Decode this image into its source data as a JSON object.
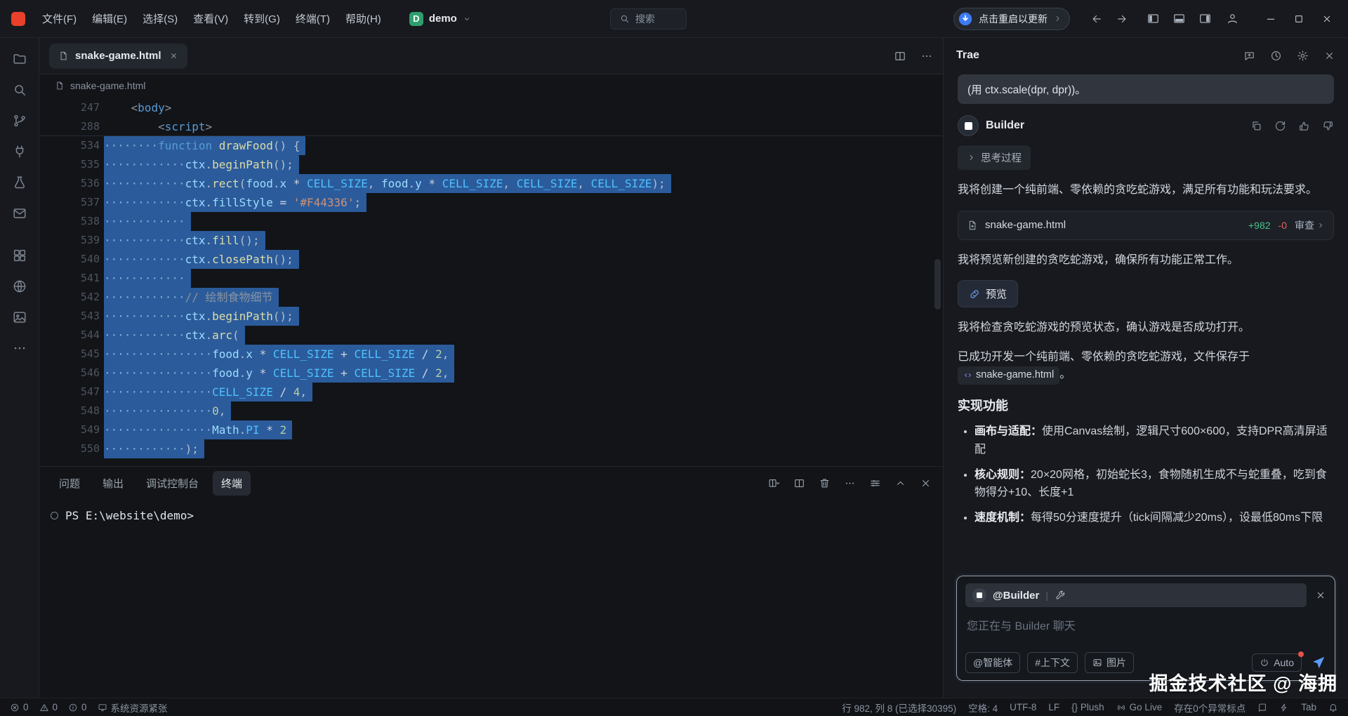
{
  "titlebar": {
    "menus": [
      "文件(F)",
      "编辑(E)",
      "选择(S)",
      "查看(V)",
      "转到(G)",
      "终端(T)",
      "帮助(H)"
    ],
    "project_initial": "D",
    "project_name": "demo",
    "search_label": "搜索",
    "update_label": "点击重启以更新"
  },
  "activity_icons": [
    "explorer",
    "search",
    "source-control",
    "debug",
    "test",
    "mail",
    "extensions",
    "globe",
    "gallery",
    "more"
  ],
  "editor": {
    "tab_name": "snake-game.html",
    "breadcrumb": "snake-game.html",
    "sticky_lines": [
      {
        "n": "247",
        "tokens": [
          [
            "    ",
            "pun"
          ],
          [
            "<",
            "dim"
          ],
          [
            "body",
            "tag"
          ],
          [
            ">",
            "dim"
          ]
        ]
      },
      {
        "n": "288",
        "tokens": [
          [
            "        ",
            "pun"
          ],
          [
            "<",
            "dim"
          ],
          [
            "script",
            "tag"
          ],
          [
            ">",
            "dim"
          ]
        ]
      }
    ],
    "code_lines": [
      {
        "n": "534",
        "sel": true,
        "ws": 8,
        "tokens": [
          [
            "function",
            "kw"
          ],
          [
            " ",
            "op"
          ],
          [
            "drawFood",
            "fn"
          ],
          [
            "() {",
            "pun"
          ]
        ]
      },
      {
        "n": "535",
        "sel": true,
        "ws": 12,
        "tokens": [
          [
            "ctx",
            "var"
          ],
          [
            ".",
            "pun"
          ],
          [
            "beginPath",
            "fn"
          ],
          [
            "();",
            "pun"
          ]
        ]
      },
      {
        "n": "536",
        "sel": true,
        "ws": 12,
        "tokens": [
          [
            "ctx",
            "var"
          ],
          [
            ".",
            "pun"
          ],
          [
            "rect",
            "fn"
          ],
          [
            "(",
            "pun"
          ],
          [
            "food",
            "var"
          ],
          [
            ".",
            "pun"
          ],
          [
            "x",
            "prop"
          ],
          [
            " * ",
            "op"
          ],
          [
            "CELL_SIZE",
            "const"
          ],
          [
            ", ",
            "pun"
          ],
          [
            "food",
            "var"
          ],
          [
            ".",
            "pun"
          ],
          [
            "y",
            "prop"
          ],
          [
            " * ",
            "op"
          ],
          [
            "CELL_SIZE",
            "const"
          ],
          [
            ", ",
            "pun"
          ],
          [
            "CELL_SIZE",
            "const"
          ],
          [
            ", ",
            "pun"
          ],
          [
            "CELL_SIZE",
            "const"
          ],
          [
            ");",
            "pun"
          ]
        ]
      },
      {
        "n": "537",
        "sel": true,
        "ws": 12,
        "tokens": [
          [
            "ctx",
            "var"
          ],
          [
            ".",
            "pun"
          ],
          [
            "fillStyle",
            "prop"
          ],
          [
            " = ",
            "op"
          ],
          [
            "'#F44336'",
            "str"
          ],
          [
            ";",
            "pun"
          ]
        ]
      },
      {
        "n": "538",
        "sel": true,
        "ws": 12,
        "tokens": []
      },
      {
        "n": "539",
        "sel": true,
        "ws": 12,
        "tokens": [
          [
            "ctx",
            "var"
          ],
          [
            ".",
            "pun"
          ],
          [
            "fill",
            "fn"
          ],
          [
            "();",
            "pun"
          ]
        ]
      },
      {
        "n": "540",
        "sel": true,
        "ws": 12,
        "tokens": [
          [
            "ctx",
            "var"
          ],
          [
            ".",
            "pun"
          ],
          [
            "closePath",
            "fn"
          ],
          [
            "();",
            "pun"
          ]
        ]
      },
      {
        "n": "541",
        "sel": true,
        "ws": 12,
        "tokens": []
      },
      {
        "n": "542",
        "sel": true,
        "ws": 12,
        "tokens": [
          [
            "// 绘制食物细节",
            "cm"
          ]
        ]
      },
      {
        "n": "543",
        "sel": true,
        "ws": 12,
        "tokens": [
          [
            "ctx",
            "var"
          ],
          [
            ".",
            "pun"
          ],
          [
            "beginPath",
            "fn"
          ],
          [
            "();",
            "pun"
          ]
        ]
      },
      {
        "n": "544",
        "sel": true,
        "ws": 12,
        "tokens": [
          [
            "ctx",
            "var"
          ],
          [
            ".",
            "pun"
          ],
          [
            "arc",
            "fn"
          ],
          [
            "(",
            "pun"
          ]
        ]
      },
      {
        "n": "545",
        "sel": true,
        "ws": 16,
        "tokens": [
          [
            "food",
            "var"
          ],
          [
            ".",
            "pun"
          ],
          [
            "x",
            "prop"
          ],
          [
            " * ",
            "op"
          ],
          [
            "CELL_SIZE",
            "const"
          ],
          [
            " + ",
            "op"
          ],
          [
            "CELL_SIZE",
            "const"
          ],
          [
            " / ",
            "op"
          ],
          [
            "2",
            "num"
          ],
          [
            ",",
            "pun"
          ]
        ]
      },
      {
        "n": "546",
        "sel": true,
        "ws": 16,
        "tokens": [
          [
            "food",
            "var"
          ],
          [
            ".",
            "pun"
          ],
          [
            "y",
            "prop"
          ],
          [
            " * ",
            "op"
          ],
          [
            "CELL_SIZE",
            "const"
          ],
          [
            " + ",
            "op"
          ],
          [
            "CELL_SIZE",
            "const"
          ],
          [
            " / ",
            "op"
          ],
          [
            "2",
            "num"
          ],
          [
            ",",
            "pun"
          ]
        ]
      },
      {
        "n": "547",
        "sel": true,
        "ws": 16,
        "tokens": [
          [
            "CELL_SIZE",
            "const"
          ],
          [
            " / ",
            "op"
          ],
          [
            "4",
            "num"
          ],
          [
            ",",
            "pun"
          ]
        ]
      },
      {
        "n": "548",
        "sel": true,
        "ws": 16,
        "tokens": [
          [
            "0",
            "num"
          ],
          [
            ",",
            "pun"
          ]
        ]
      },
      {
        "n": "549",
        "sel": true,
        "ws": 16,
        "tokens": [
          [
            "Math",
            "var"
          ],
          [
            ".",
            "pun"
          ],
          [
            "PI",
            "const"
          ],
          [
            " * ",
            "op"
          ],
          [
            "2",
            "num"
          ]
        ]
      },
      {
        "n": "550",
        "sel": true,
        "ws": 12,
        "tokens": [
          [
            ");",
            "pun"
          ]
        ]
      }
    ]
  },
  "panel": {
    "tabs": [
      "问题",
      "输出",
      "调试控制台",
      "终端"
    ],
    "active": "终端",
    "prompt": "PS E:\\website\\demo>"
  },
  "chat": {
    "title": "Trae",
    "bubble": "(用 ctx.scale(dpr, dpr))。",
    "agent": "Builder",
    "thinking": "思考过程",
    "p1": "我将创建一个纯前端、零依赖的贪吃蛇游戏，满足所有功能和玩法要求。",
    "file_card": {
      "name": "snake-game.html",
      "added": "+982",
      "removed": "-0",
      "review": "审查"
    },
    "p2": "我将预览新创建的贪吃蛇游戏，确保所有功能正常工作。",
    "preview": "预览",
    "p3": "我将检查贪吃蛇游戏的预览状态，确认游戏是否成功打开。",
    "p4_before": "已成功开发一个纯前端、零依赖的贪吃蛇游戏，文件保存于",
    "p4_file": "snake-game.html",
    "p4_after": "。",
    "features_title": "实现功能",
    "bullets": [
      {
        "lead": "画布与适配：",
        "text": "使用Canvas绘制，逻辑尺寸600×600，支持DPR高清屏适配"
      },
      {
        "lead": "核心规则：",
        "text": "20×20网格，初始蛇长3，食物随机生成不与蛇重叠，吃到食物得分+10、长度+1"
      },
      {
        "lead": "速度机制：",
        "text": "每得50分速度提升（tick间隔减少20ms），设最低80ms下限"
      }
    ],
    "input": {
      "mention": "@Builder",
      "placeholder": "您正在与 Builder 聊天",
      "chips": [
        {
          "label": "@智能体"
        },
        {
          "label": "#上下文"
        },
        {
          "label": "图片",
          "icon": "image"
        }
      ],
      "auto": "Auto"
    }
  },
  "statusbar": {
    "errors": "0",
    "warnings": "0",
    "infos": "0",
    "resource": "系统资源紧张",
    "right": [
      {
        "label": "行 982, 列 8 (已选择30395)"
      },
      {
        "label": "空格: 4"
      },
      {
        "label": "UTF-8"
      },
      {
        "label": "LF"
      },
      {
        "label": "{} Plush"
      },
      {
        "label": "Go Live",
        "icon": "broadcast"
      },
      {
        "label": "存在0个异常标点"
      },
      {
        "icon": "book"
      },
      {
        "icon": "zap"
      },
      {
        "label": "Tab"
      },
      {
        "icon": "bell"
      }
    ]
  },
  "watermark": "掘金技术社区 @ 海拥"
}
